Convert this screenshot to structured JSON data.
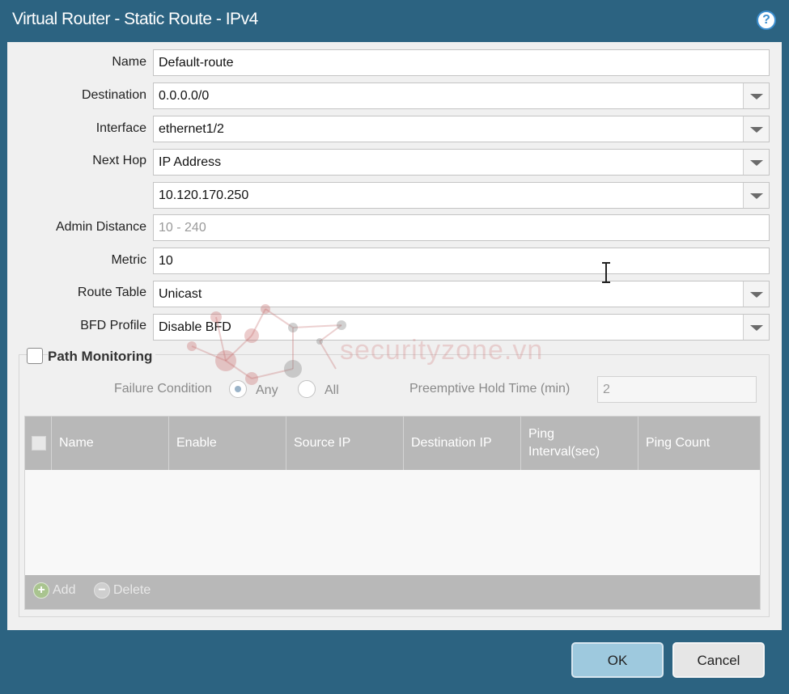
{
  "dialog": {
    "title": "Virtual Router - Static Route - IPv4",
    "help_icon": "?"
  },
  "form": {
    "name": {
      "label": "Name",
      "value": "Default-route"
    },
    "destination": {
      "label": "Destination",
      "value": "0.0.0.0/0"
    },
    "interface": {
      "label": "Interface",
      "value": "ethernet1/2"
    },
    "next_hop": {
      "label": "Next Hop",
      "value": "IP Address"
    },
    "next_hop_ip": {
      "value": "10.120.170.250"
    },
    "admin_distance": {
      "label": "Admin Distance",
      "placeholder": "10 - 240"
    },
    "metric": {
      "label": "Metric",
      "value": "10"
    },
    "route_table": {
      "label": "Route Table",
      "value": "Unicast"
    },
    "bfd_profile": {
      "label": "BFD Profile",
      "value": "Disable BFD"
    }
  },
  "path_monitoring": {
    "label": "Path Monitoring",
    "checked": false,
    "failure_condition": {
      "label": "Failure Condition",
      "options": [
        "Any",
        "All"
      ],
      "selected": "Any"
    },
    "preemptive_hold": {
      "label": "Preemptive Hold Time (min)",
      "value": "2"
    },
    "table": {
      "columns": [
        "Name",
        "Enable",
        "Source IP",
        "Destination IP",
        "Ping Interval(sec)",
        "Ping Count"
      ],
      "rows": []
    },
    "add_label": "Add",
    "delete_label": "Delete"
  },
  "buttons": {
    "ok": "OK",
    "cancel": "Cancel"
  },
  "watermark": "securityzone.vn",
  "colors": {
    "titlebar": "#2c6381",
    "panel": "#f0f0f0",
    "ok_button": "#9ec9de",
    "grid_header": "#b8b8b8"
  }
}
